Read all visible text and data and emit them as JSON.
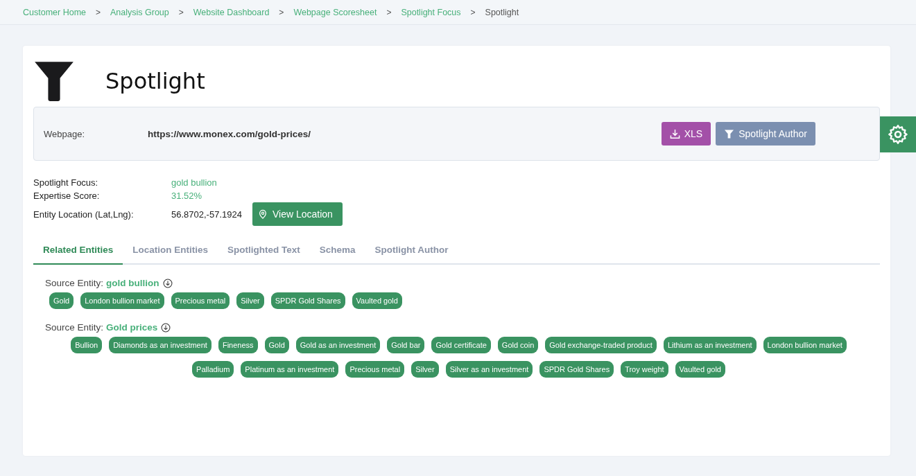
{
  "breadcrumbs": [
    {
      "label": "Customer Home",
      "current": false
    },
    {
      "label": "Analysis Group",
      "current": false
    },
    {
      "label": "Website Dashboard",
      "current": false
    },
    {
      "label": "Webpage Scoresheet",
      "current": false
    },
    {
      "label": "Spotlight Focus",
      "current": false
    },
    {
      "label": "Spotlight",
      "current": true
    }
  ],
  "separator": ">",
  "page_title": "Spotlight",
  "webpage": {
    "label": "Webpage:",
    "url": "https://www.monex.com/gold-prices/"
  },
  "actions": [
    {
      "label": "XLS",
      "kind": "download"
    },
    {
      "label": "Spotlight Author",
      "kind": "filter"
    }
  ],
  "details": [
    {
      "label": "Spotlight Focus:",
      "value": "gold bullion",
      "kind": "link"
    },
    {
      "label": "Expertise Score:",
      "value": "31.52%",
      "kind": "link"
    },
    {
      "label": "Entity Location (Lat,Lng):",
      "value": "56.8702,-57.1924",
      "kind": "location",
      "button": "View Location"
    }
  ],
  "tabs": [
    {
      "label": "Related Entities",
      "selected": true
    },
    {
      "label": "Location Entities",
      "selected": false
    },
    {
      "label": "Spotlighted Text",
      "selected": false
    },
    {
      "label": "Schema",
      "selected": false
    },
    {
      "label": "Spotlight Author",
      "selected": false
    }
  ],
  "source_groups": [
    {
      "label": "Source Entity:",
      "entity": "gold bullion",
      "tags": [
        "Gold",
        "London bullion market",
        "Precious metal",
        "Silver",
        "SPDR Gold Shares",
        "Vaulted gold"
      ]
    },
    {
      "label": "Source Entity:",
      "entity": "Gold prices",
      "tags": [
        "Bullion",
        "Diamonds as an investment",
        "Fineness",
        "Gold",
        "Gold as an investment",
        "Gold bar",
        "Gold certificate",
        "Gold coin",
        "Gold exchange-traded product",
        "Lithium as an investment",
        "London bullion market",
        "Palladium",
        "Platinum as an investment",
        "Precious metal",
        "Silver",
        "Silver as an investment",
        "SPDR Gold Shares",
        "Troy weight",
        "Vaulted gold"
      ]
    }
  ]
}
